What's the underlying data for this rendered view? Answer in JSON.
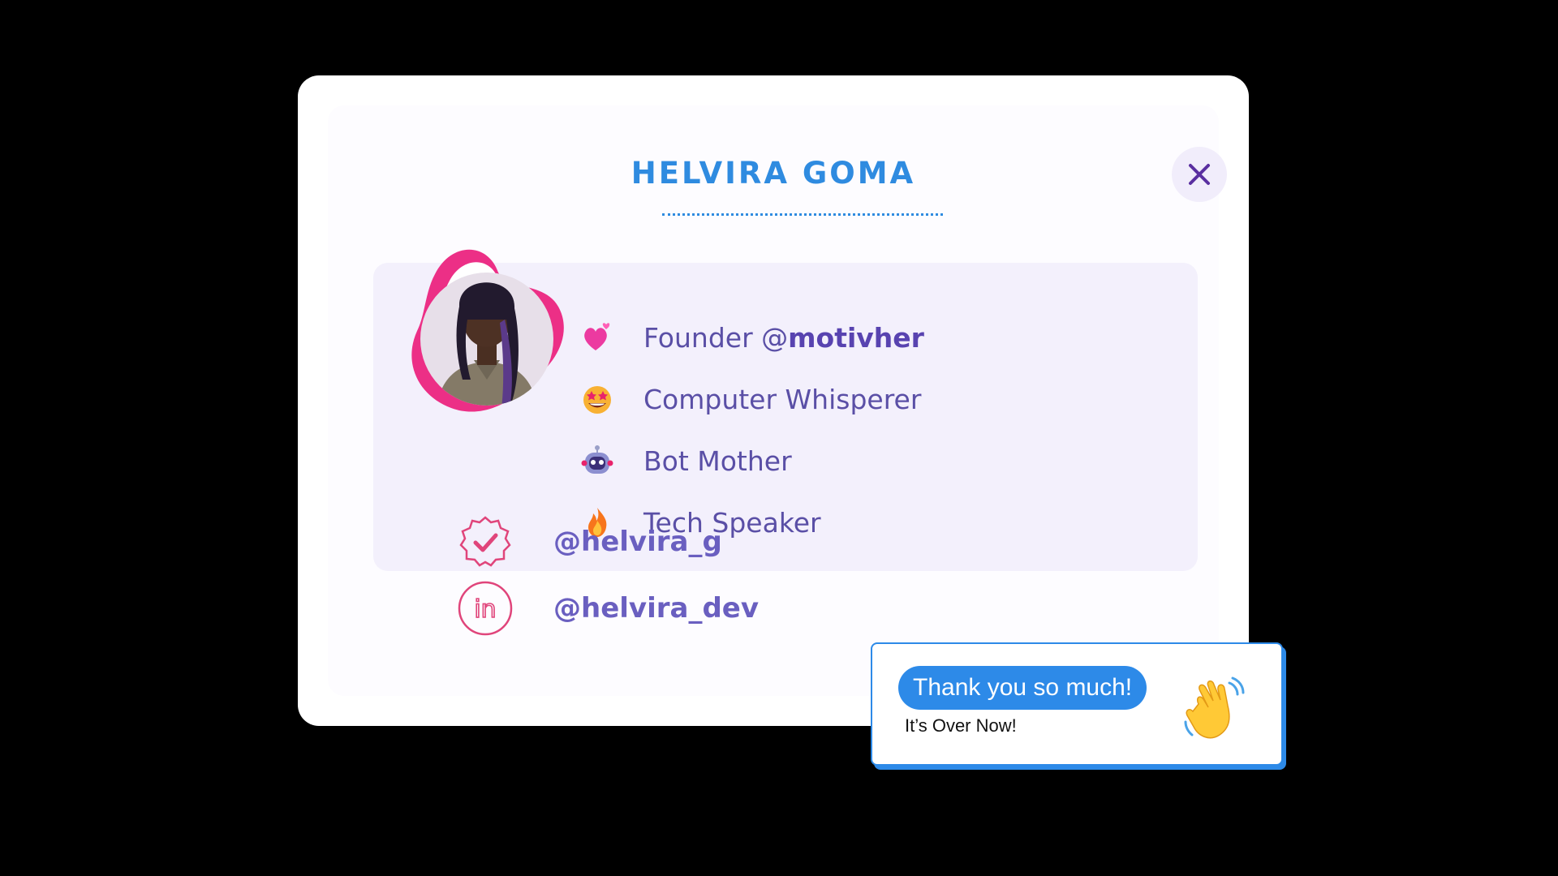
{
  "profile": {
    "name": "HELVIRA GOMA",
    "close_icon": "close-icon"
  },
  "bio": {
    "items": [
      {
        "icon": "heart-icon",
        "prefix": "Founder @",
        "bold": "motivher"
      },
      {
        "icon": "star-struck-face-icon",
        "prefix": "Computer Whisperer",
        "bold": ""
      },
      {
        "icon": "robot-icon",
        "prefix": "Bot Mother",
        "bold": ""
      },
      {
        "icon": "fire-icon",
        "prefix": "Tech Speaker",
        "bold": ""
      }
    ]
  },
  "social": {
    "twitter_handle": "@helvira_g",
    "twitter_icon": "verified-badge-icon",
    "linkedin_handle": "@helvira_dev",
    "linkedin_icon": "linkedin-icon"
  },
  "chat": {
    "message": "Thank you so much!",
    "subtitle": "It’s Over Now!",
    "emoji": "waving-hand-icon"
  },
  "colors": {
    "accent_blue": "#2f8be0",
    "accent_purple": "#5a4fa6",
    "accent_pink": "#e0457b",
    "panel": "#f3f0fc"
  }
}
